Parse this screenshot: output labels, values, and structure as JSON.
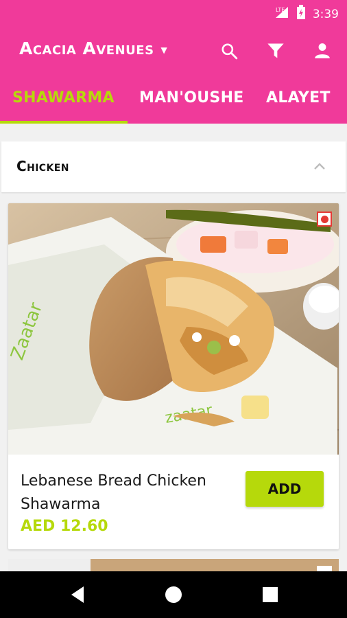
{
  "status": {
    "network": "LTE",
    "time": "3:39"
  },
  "appbar": {
    "location": "Acacia Avenues"
  },
  "tabs": [
    {
      "label": "SHAWARMA",
      "active": true
    },
    {
      "label": "MAN'OUSHE",
      "active": false
    },
    {
      "label": "ALAYET",
      "active": false
    }
  ],
  "category": {
    "title": "Chicken",
    "expanded": true
  },
  "items": [
    {
      "name": "Lebanese Bread Chicken Shawarma",
      "price": "AED 12.60",
      "add_label": "ADD"
    }
  ],
  "colors": {
    "brand": "#f03a9a",
    "accent": "#b6d90b",
    "badge": "#e53935"
  },
  "icons": [
    "search-icon",
    "filter-icon",
    "user-icon",
    "caret-down-icon",
    "chevron-up-icon",
    "back-icon",
    "home-icon",
    "recents-icon"
  ]
}
